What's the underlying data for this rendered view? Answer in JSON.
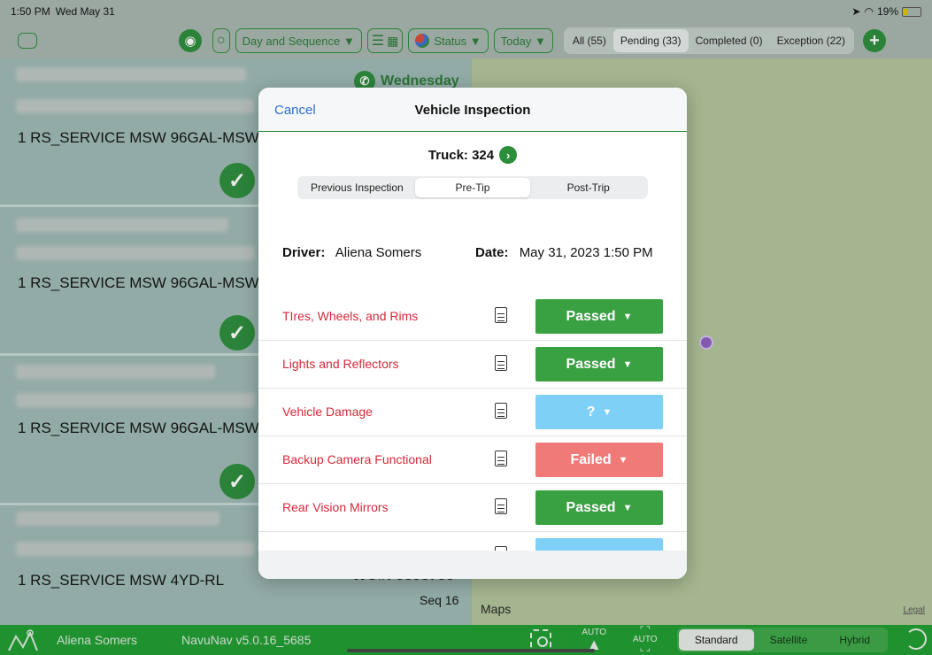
{
  "status_bar": {
    "time": "1:50 PM",
    "date": "Wed May 31",
    "battery": "19%"
  },
  "toolbar": {
    "sort_label": "Day and Sequence ▼",
    "status_label": "Status ▼",
    "today_label": "Today ▼",
    "filters": [
      {
        "label": "All (55)",
        "active": false
      },
      {
        "label": "Pending (33)",
        "active": true
      },
      {
        "label": "Completed (0)",
        "active": false
      },
      {
        "label": "Exception (22)",
        "active": false
      }
    ]
  },
  "list": {
    "day": "Wednesday",
    "items": [
      {
        "service": "1 RS_SERVICE MSW 96GAL-MSW"
      },
      {
        "service": "1 RS_SERVICE MSW 96GAL-MSW"
      },
      {
        "service": "1 RS_SERVICE MSW 96GAL-MSW"
      },
      {
        "service": "1 RS_SERVICE MSW 4YD-RL"
      }
    ],
    "wo": "WO#: 5898755",
    "seq": "Seq 16"
  },
  "map": {
    "brand": "Maps",
    "legal": "Legal"
  },
  "modal": {
    "cancel_label": "Cancel",
    "title": "Vehicle Inspection",
    "truck_label": "Truck: 324",
    "tabs": [
      "Previous Inspection",
      "Pre-Tip",
      "Post-Trip"
    ],
    "active_tab": "Pre-Tip",
    "driver_label": "Driver:",
    "driver_name": "Aliena Somers",
    "date_label": "Date:",
    "date_value": "May 31, 2023 1:50 PM",
    "items": [
      {
        "label": "TIres, Wheels, and Rims",
        "status": "Passed",
        "color": "#3aa143"
      },
      {
        "label": "Lights and Reflectors",
        "status": "Passed",
        "color": "#3aa143"
      },
      {
        "label": "Vehicle Damage",
        "status": "?",
        "color": "#7fd0f7"
      },
      {
        "label": "Backup Camera Functional",
        "status": "Failed",
        "color": "#f07a78"
      },
      {
        "label": "Rear Vision Mirrors",
        "status": "Passed",
        "color": "#3aa143"
      }
    ],
    "dropdown_arrow": "▼"
  },
  "bottom_bar": {
    "user": "Aliena Somers",
    "version": "NavuNav v5.0.16_5685",
    "auto_label": "AUTO",
    "map_modes": [
      "Standard",
      "Satellite",
      "Hybrid"
    ],
    "active_mode": "Standard"
  },
  "colors": {
    "brand_green": "#2c8d3a",
    "bottom_green": "#1f9d2f",
    "link_blue": "#2a6fd6",
    "warning_red": "#d6283a"
  }
}
